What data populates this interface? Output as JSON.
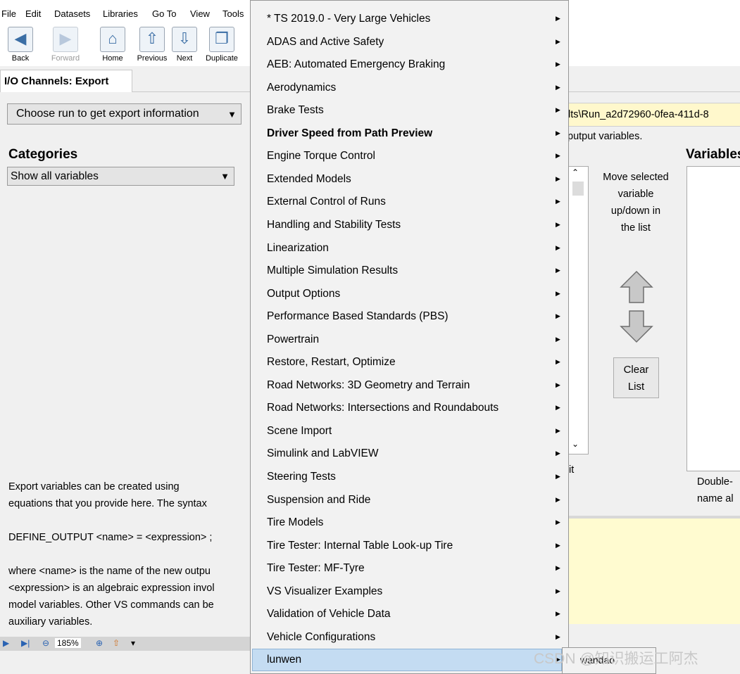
{
  "menubar": [
    "File",
    "Edit",
    "Datasets",
    "Libraries",
    "Go To",
    "View",
    "Tools"
  ],
  "toolbar": {
    "back": "Back",
    "forward": "Forward",
    "home": "Home",
    "previous": "Previous",
    "next": "Next",
    "duplicate": "Duplicate"
  },
  "tab": "I/O Channels: Export",
  "run_dropdown": "Choose run to get export information",
  "categories": {
    "heading": "Categories",
    "selected": "Show all variables"
  },
  "help": "Export variables can be created using\nequations that you provide here. The syntax\n\nDEFINE_OUTPUT <name> = <expression> ;\n\nwhere <name> is the name of the new outpu\n<expression> is an algebraic expression invol\nmodel variables. Other VS commands can be\nauxiliary variables.",
  "statusbar": {
    "zoom": "185%"
  },
  "right": {
    "path": "lts\\Run_a2d72960-0fea-411d-8",
    "output_text": "putput variables.",
    "variables_heading": "Variables",
    "move_text": "Move selected variable up/down in the list",
    "clear_button": "Clear List",
    "it_text": "it",
    "double_text": "Double-\nname al"
  },
  "menu": {
    "items": [
      {
        "label": "* TS 2019.0 - Very Large Vehicles",
        "bold": false
      },
      {
        "label": "ADAS and Active Safety",
        "bold": false
      },
      {
        "label": "AEB: Automated Emergency Braking",
        "bold": false
      },
      {
        "label": "Aerodynamics",
        "bold": false
      },
      {
        "label": "Brake Tests",
        "bold": false
      },
      {
        "label": "Driver Speed from Path Preview",
        "bold": true
      },
      {
        "label": "Engine Torque Control",
        "bold": false
      },
      {
        "label": "Extended Models",
        "bold": false
      },
      {
        "label": "External Control of Runs",
        "bold": false
      },
      {
        "label": "Handling and Stability Tests",
        "bold": false
      },
      {
        "label": "Linearization",
        "bold": false
      },
      {
        "label": "Multiple Simulation Results",
        "bold": false
      },
      {
        "label": "Output Options",
        "bold": false
      },
      {
        "label": "Performance Based Standards (PBS)",
        "bold": false
      },
      {
        "label": "Powertrain",
        "bold": false
      },
      {
        "label": "Restore, Restart, Optimize",
        "bold": false
      },
      {
        "label": "Road Networks: 3D Geometry and Terrain",
        "bold": false
      },
      {
        "label": "Road Networks: Intersections and Roundabouts",
        "bold": false
      },
      {
        "label": "Scene Import",
        "bold": false
      },
      {
        "label": "Simulink and LabVIEW",
        "bold": false
      },
      {
        "label": "Steering Tests",
        "bold": false
      },
      {
        "label": "Suspension and Ride",
        "bold": false
      },
      {
        "label": "Tire Models",
        "bold": false
      },
      {
        "label": "Tire Tester: Internal Table Look-up Tire",
        "bold": false
      },
      {
        "label": "Tire Tester: MF-Tyre",
        "bold": false
      },
      {
        "label": "VS Visualizer Examples",
        "bold": false
      },
      {
        "label": "Validation of Vehicle Data",
        "bold": false
      },
      {
        "label": "Vehicle Configurations",
        "bold": false
      },
      {
        "label": "lunwen",
        "bold": false
      }
    ],
    "submenu_item": "wandao"
  },
  "watermark": "CSDN @知识搬运工阿杰",
  "icons": {
    "back": "arrow-left-icon",
    "forward": "arrow-right-icon",
    "home": "home-icon",
    "previous": "arrow-up-icon",
    "next": "arrow-down-icon",
    "duplicate": "window-icon",
    "submenu_arrow": "triangle-right-icon"
  },
  "colors": {
    "menu_highlight": "#c4dcf2",
    "path_field_bg": "#fff8cc"
  }
}
